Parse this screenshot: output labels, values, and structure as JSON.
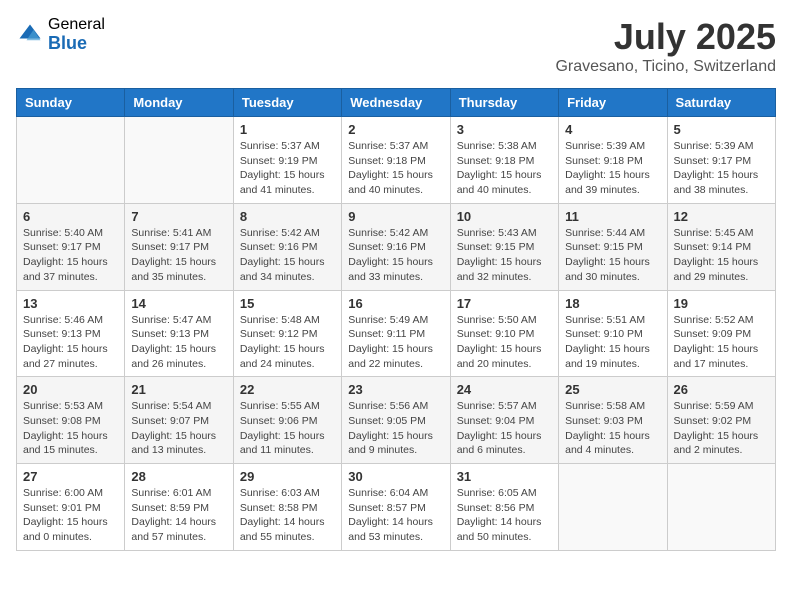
{
  "logo": {
    "general": "General",
    "blue": "Blue"
  },
  "title": "July 2025",
  "location": "Gravesano, Ticino, Switzerland",
  "weekdays": [
    "Sunday",
    "Monday",
    "Tuesday",
    "Wednesday",
    "Thursday",
    "Friday",
    "Saturday"
  ],
  "weeks": [
    [
      {
        "day": "",
        "sunrise": "",
        "sunset": "",
        "daylight": ""
      },
      {
        "day": "",
        "sunrise": "",
        "sunset": "",
        "daylight": ""
      },
      {
        "day": "1",
        "sunrise": "Sunrise: 5:37 AM",
        "sunset": "Sunset: 9:19 PM",
        "daylight": "Daylight: 15 hours and 41 minutes."
      },
      {
        "day": "2",
        "sunrise": "Sunrise: 5:37 AM",
        "sunset": "Sunset: 9:18 PM",
        "daylight": "Daylight: 15 hours and 40 minutes."
      },
      {
        "day": "3",
        "sunrise": "Sunrise: 5:38 AM",
        "sunset": "Sunset: 9:18 PM",
        "daylight": "Daylight: 15 hours and 40 minutes."
      },
      {
        "day": "4",
        "sunrise": "Sunrise: 5:39 AM",
        "sunset": "Sunset: 9:18 PM",
        "daylight": "Daylight: 15 hours and 39 minutes."
      },
      {
        "day": "5",
        "sunrise": "Sunrise: 5:39 AM",
        "sunset": "Sunset: 9:17 PM",
        "daylight": "Daylight: 15 hours and 38 minutes."
      }
    ],
    [
      {
        "day": "6",
        "sunrise": "Sunrise: 5:40 AM",
        "sunset": "Sunset: 9:17 PM",
        "daylight": "Daylight: 15 hours and 37 minutes."
      },
      {
        "day": "7",
        "sunrise": "Sunrise: 5:41 AM",
        "sunset": "Sunset: 9:17 PM",
        "daylight": "Daylight: 15 hours and 35 minutes."
      },
      {
        "day": "8",
        "sunrise": "Sunrise: 5:42 AM",
        "sunset": "Sunset: 9:16 PM",
        "daylight": "Daylight: 15 hours and 34 minutes."
      },
      {
        "day": "9",
        "sunrise": "Sunrise: 5:42 AM",
        "sunset": "Sunset: 9:16 PM",
        "daylight": "Daylight: 15 hours and 33 minutes."
      },
      {
        "day": "10",
        "sunrise": "Sunrise: 5:43 AM",
        "sunset": "Sunset: 9:15 PM",
        "daylight": "Daylight: 15 hours and 32 minutes."
      },
      {
        "day": "11",
        "sunrise": "Sunrise: 5:44 AM",
        "sunset": "Sunset: 9:15 PM",
        "daylight": "Daylight: 15 hours and 30 minutes."
      },
      {
        "day": "12",
        "sunrise": "Sunrise: 5:45 AM",
        "sunset": "Sunset: 9:14 PM",
        "daylight": "Daylight: 15 hours and 29 minutes."
      }
    ],
    [
      {
        "day": "13",
        "sunrise": "Sunrise: 5:46 AM",
        "sunset": "Sunset: 9:13 PM",
        "daylight": "Daylight: 15 hours and 27 minutes."
      },
      {
        "day": "14",
        "sunrise": "Sunrise: 5:47 AM",
        "sunset": "Sunset: 9:13 PM",
        "daylight": "Daylight: 15 hours and 26 minutes."
      },
      {
        "day": "15",
        "sunrise": "Sunrise: 5:48 AM",
        "sunset": "Sunset: 9:12 PM",
        "daylight": "Daylight: 15 hours and 24 minutes."
      },
      {
        "day": "16",
        "sunrise": "Sunrise: 5:49 AM",
        "sunset": "Sunset: 9:11 PM",
        "daylight": "Daylight: 15 hours and 22 minutes."
      },
      {
        "day": "17",
        "sunrise": "Sunrise: 5:50 AM",
        "sunset": "Sunset: 9:10 PM",
        "daylight": "Daylight: 15 hours and 20 minutes."
      },
      {
        "day": "18",
        "sunrise": "Sunrise: 5:51 AM",
        "sunset": "Sunset: 9:10 PM",
        "daylight": "Daylight: 15 hours and 19 minutes."
      },
      {
        "day": "19",
        "sunrise": "Sunrise: 5:52 AM",
        "sunset": "Sunset: 9:09 PM",
        "daylight": "Daylight: 15 hours and 17 minutes."
      }
    ],
    [
      {
        "day": "20",
        "sunrise": "Sunrise: 5:53 AM",
        "sunset": "Sunset: 9:08 PM",
        "daylight": "Daylight: 15 hours and 15 minutes."
      },
      {
        "day": "21",
        "sunrise": "Sunrise: 5:54 AM",
        "sunset": "Sunset: 9:07 PM",
        "daylight": "Daylight: 15 hours and 13 minutes."
      },
      {
        "day": "22",
        "sunrise": "Sunrise: 5:55 AM",
        "sunset": "Sunset: 9:06 PM",
        "daylight": "Daylight: 15 hours and 11 minutes."
      },
      {
        "day": "23",
        "sunrise": "Sunrise: 5:56 AM",
        "sunset": "Sunset: 9:05 PM",
        "daylight": "Daylight: 15 hours and 9 minutes."
      },
      {
        "day": "24",
        "sunrise": "Sunrise: 5:57 AM",
        "sunset": "Sunset: 9:04 PM",
        "daylight": "Daylight: 15 hours and 6 minutes."
      },
      {
        "day": "25",
        "sunrise": "Sunrise: 5:58 AM",
        "sunset": "Sunset: 9:03 PM",
        "daylight": "Daylight: 15 hours and 4 minutes."
      },
      {
        "day": "26",
        "sunrise": "Sunrise: 5:59 AM",
        "sunset": "Sunset: 9:02 PM",
        "daylight": "Daylight: 15 hours and 2 minutes."
      }
    ],
    [
      {
        "day": "27",
        "sunrise": "Sunrise: 6:00 AM",
        "sunset": "Sunset: 9:01 PM",
        "daylight": "Daylight: 15 hours and 0 minutes."
      },
      {
        "day": "28",
        "sunrise": "Sunrise: 6:01 AM",
        "sunset": "Sunset: 8:59 PM",
        "daylight": "Daylight: 14 hours and 57 minutes."
      },
      {
        "day": "29",
        "sunrise": "Sunrise: 6:03 AM",
        "sunset": "Sunset: 8:58 PM",
        "daylight": "Daylight: 14 hours and 55 minutes."
      },
      {
        "day": "30",
        "sunrise": "Sunrise: 6:04 AM",
        "sunset": "Sunset: 8:57 PM",
        "daylight": "Daylight: 14 hours and 53 minutes."
      },
      {
        "day": "31",
        "sunrise": "Sunrise: 6:05 AM",
        "sunset": "Sunset: 8:56 PM",
        "daylight": "Daylight: 14 hours and 50 minutes."
      },
      {
        "day": "",
        "sunrise": "",
        "sunset": "",
        "daylight": ""
      },
      {
        "day": "",
        "sunrise": "",
        "sunset": "",
        "daylight": ""
      }
    ]
  ]
}
